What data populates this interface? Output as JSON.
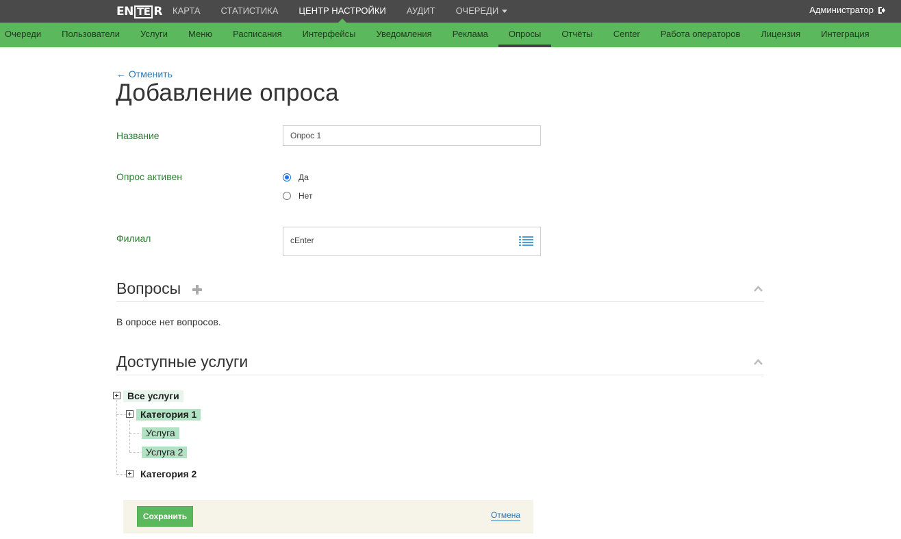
{
  "header": {
    "logo": {
      "pre": "EN",
      "box": "TE",
      "post": "R"
    },
    "nav": [
      {
        "label": "Карта",
        "active": false
      },
      {
        "label": "Статистика",
        "active": false
      },
      {
        "label": "Центр настройки",
        "active": true
      },
      {
        "label": "Аудит",
        "active": false
      },
      {
        "label": "Очереди",
        "active": false,
        "dropdown": true
      }
    ],
    "user": "Администратор",
    "user_icon": "logout-icon"
  },
  "subnav": [
    {
      "label": "Очереди"
    },
    {
      "label": "Пользователи"
    },
    {
      "label": "Услуги"
    },
    {
      "label": "Меню"
    },
    {
      "label": "Расписания"
    },
    {
      "label": "Интерфейсы"
    },
    {
      "label": "Уведомления"
    },
    {
      "label": "Реклама"
    },
    {
      "label": "Опросы",
      "active": true
    },
    {
      "label": "Отчёты"
    },
    {
      "label": "Center"
    },
    {
      "label": "Работа операторов"
    },
    {
      "label": "Лицензия"
    },
    {
      "label": "Интеграция"
    }
  ],
  "page": {
    "back_link": "← Отменить",
    "title": "Добавление опроса"
  },
  "form": {
    "name_label": "Название",
    "name_value": "Опрос 1",
    "active_label": "Опрос активен",
    "active_options": [
      {
        "label": "Да",
        "checked": true
      },
      {
        "label": "Нет",
        "checked": false
      }
    ],
    "branch_label": "Филиал",
    "branch_value": "cEnter"
  },
  "questions": {
    "title": "Вопросы",
    "empty_text": "В опросе нет вопросов."
  },
  "services": {
    "title": "Доступные услуги",
    "tree": {
      "root": "Все услуги",
      "category1": "Категория 1",
      "service1": "Услуга",
      "service2": "Услуга 2",
      "category2": "Категория 2"
    }
  },
  "footer": {
    "save_label": "Сохранить",
    "cancel_label": "Отмена"
  },
  "colors": {
    "topbar": "#4a4a4a",
    "accent_green": "#5cb85c",
    "label_green": "#2e7d32",
    "link_blue": "#2a7ab8",
    "footer_bg": "#f6f3e9",
    "tree_selected": "#b2e2c3"
  }
}
